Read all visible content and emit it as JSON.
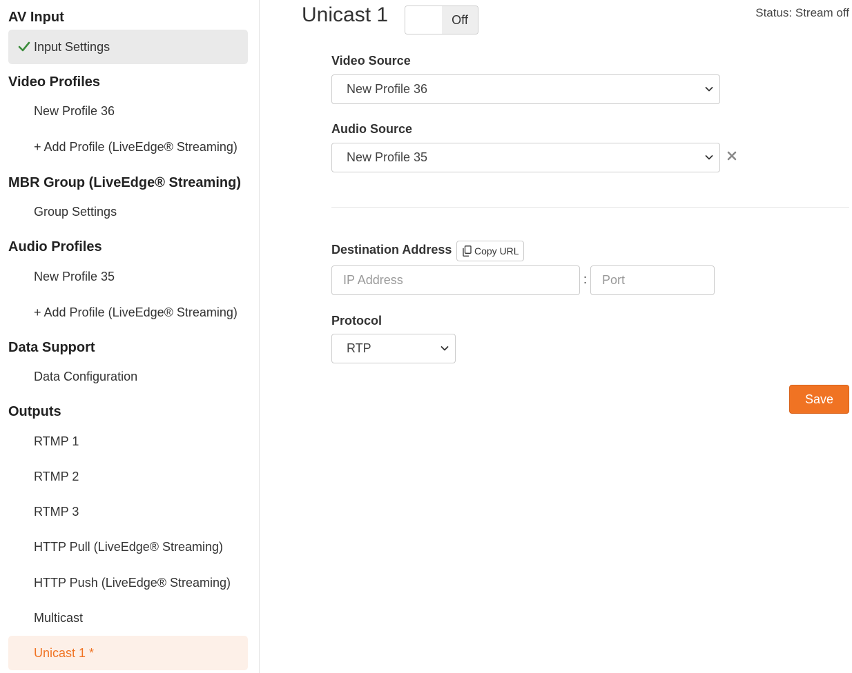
{
  "sidebar": {
    "sections": {
      "av_input": {
        "title": "AV Input",
        "items": [
          "Input Settings"
        ]
      },
      "video_profiles": {
        "title": "Video Profiles",
        "items": [
          "New Profile 36",
          "+ Add Profile (LiveEdge® Streaming)"
        ]
      },
      "mbr_group": {
        "title": "MBR Group (LiveEdge® Streaming)",
        "items": [
          "Group Settings"
        ]
      },
      "audio_profiles": {
        "title": "Audio Profiles",
        "items": [
          "New Profile 35",
          "+ Add Profile (LiveEdge® Streaming)"
        ]
      },
      "data_support": {
        "title": "Data Support",
        "items": [
          "Data Configuration"
        ]
      },
      "outputs": {
        "title": "Outputs",
        "items": [
          "RTMP 1",
          "RTMP 2",
          "RTMP 3",
          "HTTP Pull (LiveEdge® Streaming)",
          "HTTP Push (LiveEdge® Streaming)",
          "Multicast",
          "Unicast 1 *"
        ]
      }
    },
    "active_item_icon": "checkmark-icon",
    "accent_color": "#f07323",
    "check_color": "#3c8c3c"
  },
  "main": {
    "title": "Unicast 1",
    "toggle_label": "Off",
    "status": "Status: Stream off",
    "video_source": {
      "label": "Video Source",
      "value": "New Profile 36"
    },
    "audio_source": {
      "label": "Audio Source",
      "value": "New Profile 35"
    },
    "destination": {
      "label": "Destination Address",
      "copy_label": "Copy URL",
      "ip_placeholder": "IP Address",
      "port_placeholder": "Port",
      "separator": ":"
    },
    "protocol": {
      "label": "Protocol",
      "value": "RTP"
    },
    "save_label": "Save"
  }
}
